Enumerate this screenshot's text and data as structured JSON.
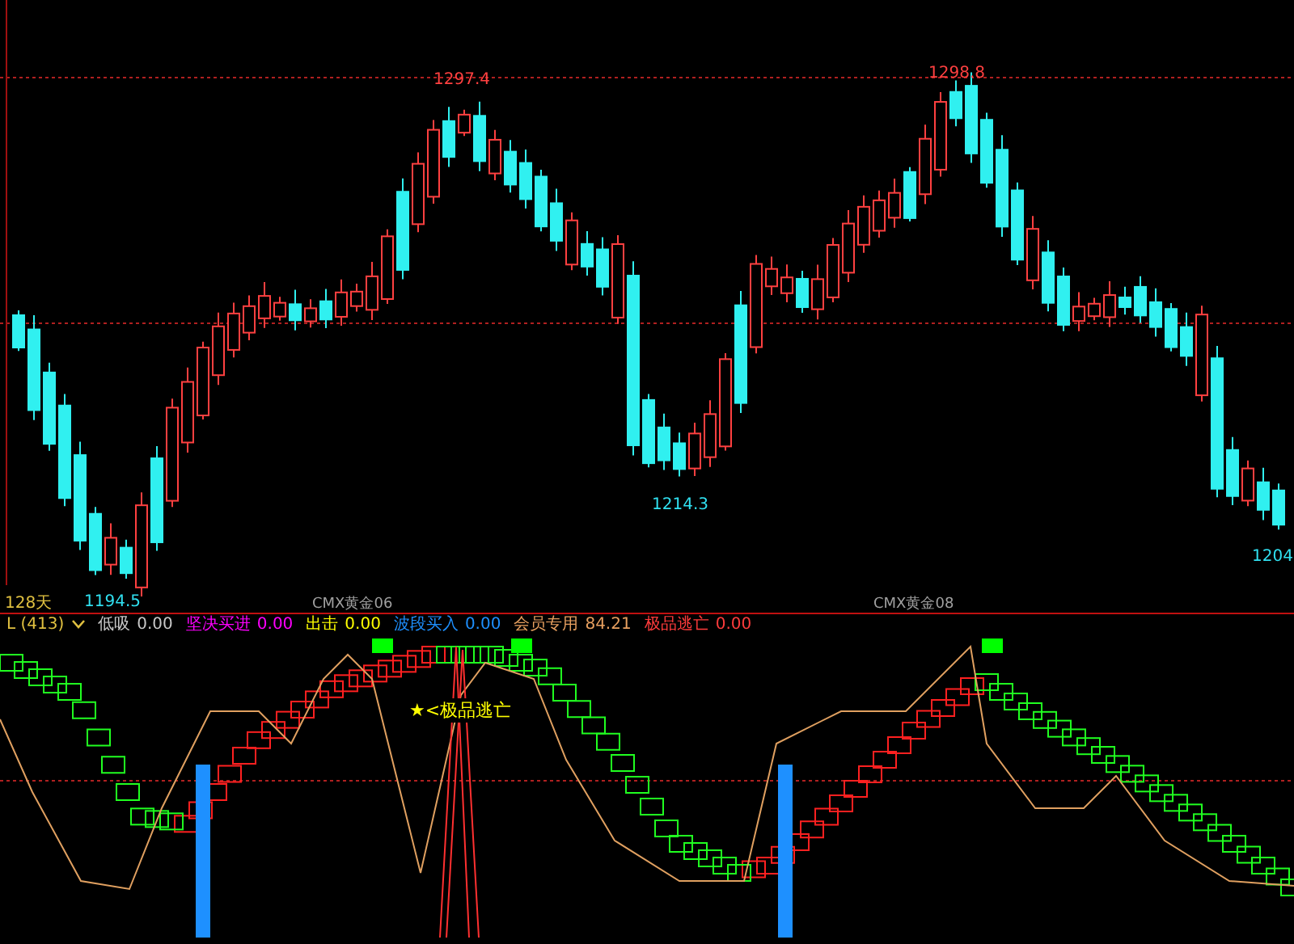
{
  "period_label": "128天",
  "contract_labels": [
    "CMX黄金06",
    "CMX黄金08"
  ],
  "price_labels": [
    {
      "text": "1297.4",
      "kind": "high"
    },
    {
      "text": "1298.8",
      "kind": "high"
    },
    {
      "text": "1194.5",
      "kind": "low"
    },
    {
      "text": "1214.3",
      "kind": "low"
    },
    {
      "text": "1204",
      "kind": "low"
    }
  ],
  "indicator": {
    "name": "L (413)",
    "legend": [
      {
        "label": "低吸",
        "value": "0.00",
        "color": "#c8c8c8"
      },
      {
        "label": "坚决买进",
        "value": "0.00",
        "color": "#ff00ff"
      },
      {
        "label": "出击",
        "value": "0.00",
        "color": "#ffff00"
      },
      {
        "label": "波段买入",
        "value": "0.00",
        "color": "#1e90ff"
      },
      {
        "label": "会员专用",
        "value": "84.21",
        "color": "#e8a060"
      },
      {
        "label": "极品逃亡",
        "value": "0.00",
        "color": "#ff3c3c"
      }
    ]
  },
  "signal_text": "★<极品逃亡"
}
